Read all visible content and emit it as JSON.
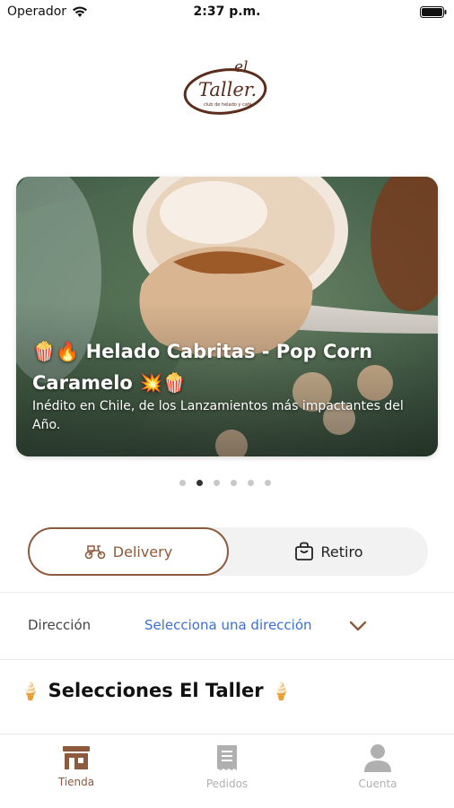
{
  "status_bar": {
    "carrier": "Operador",
    "time": "2:37 p.m."
  },
  "logo": {
    "brand": "El Taller.",
    "tagline": "club de helado y café"
  },
  "banner": {
    "title": "🍿🔥 Helado Cabritas - Pop Corn Caramelo 💥🍿",
    "subtitle": "Inédito en Chile, de los Lanzamientos más impactantes del Año.",
    "page_count": 6,
    "active_index": 1
  },
  "order_mode": {
    "delivery_label": "Delivery",
    "pickup_label": "Retiro",
    "selected": "Delivery"
  },
  "address": {
    "label": "Dirección",
    "placeholder": "Selecciona una dirección"
  },
  "section": {
    "title": "Selecciones El Taller",
    "icon": "🍦"
  },
  "tab_bar": {
    "tabs": [
      {
        "label": "Tienda",
        "icon": "store-icon",
        "active": true
      },
      {
        "label": "Pedidos",
        "icon": "receipt-icon",
        "active": false
      },
      {
        "label": "Cuenta",
        "icon": "user-icon",
        "active": false
      }
    ]
  },
  "colors": {
    "accent": "#8c5a3c",
    "link": "#3b6fd6",
    "inactive": "#b0b0b0"
  }
}
